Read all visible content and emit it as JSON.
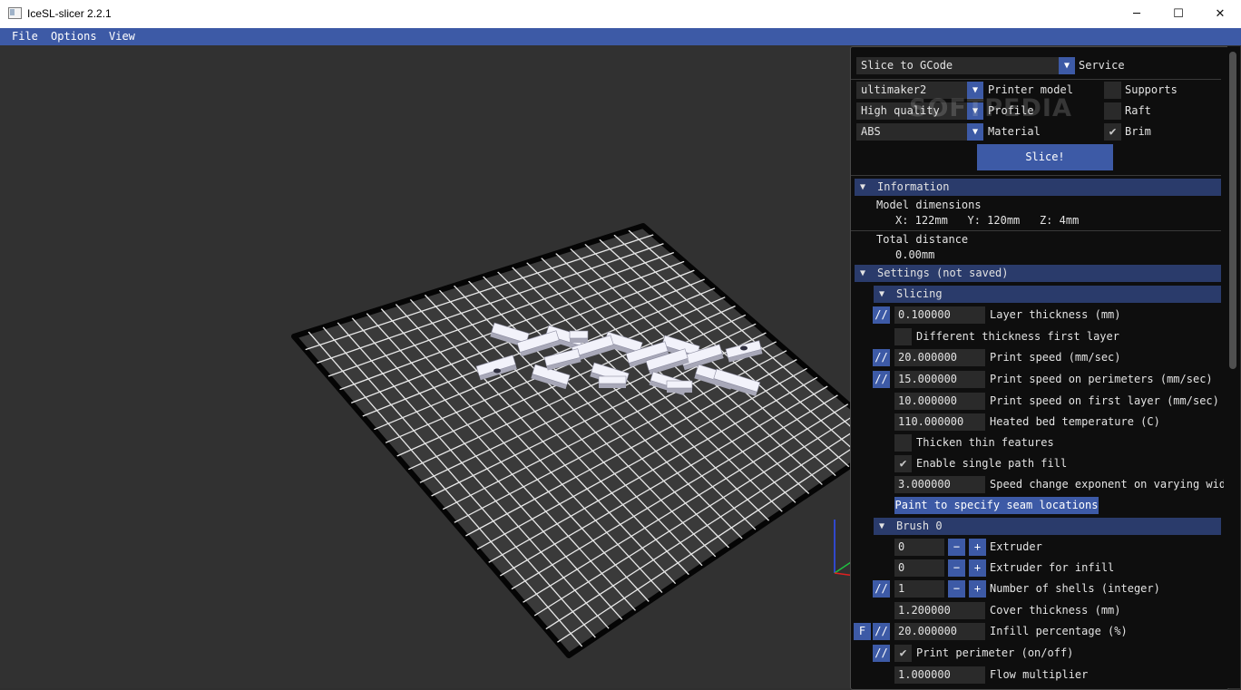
{
  "window": {
    "title": "IceSL-slicer 2.2.1",
    "minimize_glyph": "─",
    "maximize_glyph": "☐",
    "close_glyph": "✕"
  },
  "menu": {
    "file": "File",
    "options": "Options",
    "view": "View"
  },
  "watermark": "SOFTPEDIA",
  "panel": {
    "service": {
      "value": "Slice to GCode",
      "label": "Service"
    },
    "printer_model": {
      "value": "ultimaker2",
      "label": "Printer model"
    },
    "profile": {
      "value": "High quality",
      "label": "Profile"
    },
    "material": {
      "value": "ABS",
      "label": "Material"
    },
    "supports": {
      "label": "Supports",
      "checked": false
    },
    "raft": {
      "label": "Raft",
      "checked": false
    },
    "brim": {
      "label": "Brim",
      "checked": true
    },
    "slice_button": "Slice!",
    "information": {
      "header": "Information",
      "model_dimensions_label": "Model dimensions",
      "model_dimensions_value": "X: 122mm   Y: 120mm   Z: 4mm",
      "total_distance_label": "Total distance",
      "total_distance_value": "0.00mm"
    },
    "settings_header": "Settings (not saved)",
    "slicing": {
      "header": "Slicing",
      "layer_thickness": {
        "value": "0.100000",
        "label": "Layer thickness (mm)"
      },
      "different_thickness": {
        "label": "Different thickness first layer"
      },
      "print_speed": {
        "value": "20.000000",
        "label": "Print speed (mm/sec)"
      },
      "print_speed_perimeters": {
        "value": "15.000000",
        "label": "Print speed on perimeters (mm/sec)"
      },
      "print_speed_first_layer": {
        "value": "10.000000",
        "label": "Print speed on first layer (mm/sec)"
      },
      "heated_bed": {
        "value": "110.000000",
        "label": "Heated bed temperature (C)"
      },
      "thicken_thin": {
        "label": "Thicken thin features"
      },
      "single_path_fill": {
        "label": "Enable single path fill"
      },
      "speed_change": {
        "value": "3.000000",
        "label": "Speed change exponent on varying widt"
      },
      "paint_seam": "Paint to specify seam locations"
    },
    "brush": {
      "header": "Brush 0",
      "extruder": {
        "value": "0",
        "label": "Extruder"
      },
      "extruder_infill": {
        "value": "0",
        "label": "Extruder for infill"
      },
      "shells": {
        "value": "1",
        "label": "Number of shells (integer)"
      },
      "cover_thickness": {
        "value": "1.200000",
        "label": "Cover thickness (mm)"
      },
      "infill_percentage": {
        "value": "20.000000",
        "label": "Infill percentage (%)"
      },
      "print_perimeter": {
        "label": "Print perimeter (on/off)"
      },
      "flow_multiplier": {
        "value": "1.000000",
        "label": "Flow multiplier"
      }
    },
    "btn": {
      "slash": "//",
      "f": "F",
      "minus": "−",
      "plus": "+",
      "arrow": "▼",
      "check": "✔"
    }
  },
  "colors": {
    "accent": "#3d5aa6",
    "header": "#2a3b6b",
    "panel_bg": "#0e0e0e",
    "viewport_bg": "#313131"
  }
}
